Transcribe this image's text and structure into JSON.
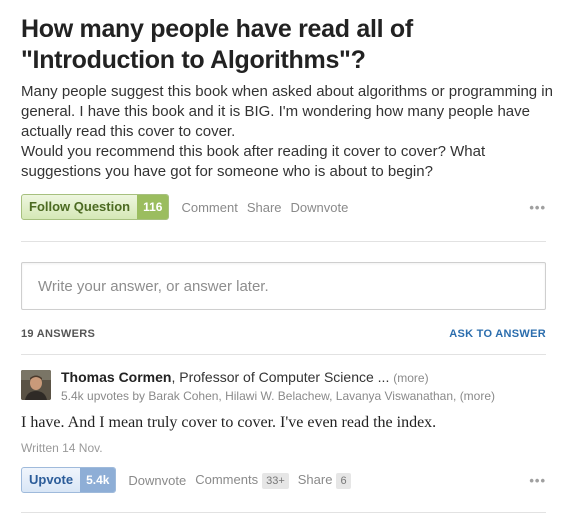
{
  "question": {
    "title": "How many people have read all of \"Introduction to Algorithms\"?",
    "body_line1": "Many people suggest this book when asked about algorithms or programming in general. I have this book and it is BIG. I'm wondering how many people have actually read this cover to cover.",
    "body_line2": "Would you recommend this book after reading it cover to cover? What suggestions you have got for someone who is about to begin?",
    "follow_label": "Follow Question",
    "follow_count": "116",
    "comment_label": "Comment",
    "share_label": "Share",
    "downvote_label": "Downvote",
    "more_icon": "ellipsis-icon"
  },
  "answer_input": {
    "placeholder": "Write your answer, or answer later.",
    "value": ""
  },
  "answers_header": {
    "count_label": "19 ANSWERS",
    "ask_label": "ASK TO ANSWER"
  },
  "answer": {
    "author_name": "Thomas Cormen",
    "author_credential": ", Professor of Computer Science ...",
    "more_label": "(more)",
    "upvote_summary": "5.4k upvotes by ",
    "upvoters": "Barak Cohen, Hilawi W. Belachew, Lavanya Viswanathan,",
    "upvoters_more": "(more)",
    "text": "I have.  And I mean truly cover to cover.  I've even read the index.",
    "written": "Written 14 Nov.",
    "upvote_label": "Upvote",
    "upvote_count": "5.4k",
    "downvote_label": "Downvote",
    "comments_label": "Comments",
    "comments_count": "33+",
    "share_label": "Share",
    "share_count": "6"
  },
  "colors": {
    "follow_green": "#9bbd5f",
    "upvote_blue": "#8eaed6",
    "link_blue": "#2b6dad"
  }
}
